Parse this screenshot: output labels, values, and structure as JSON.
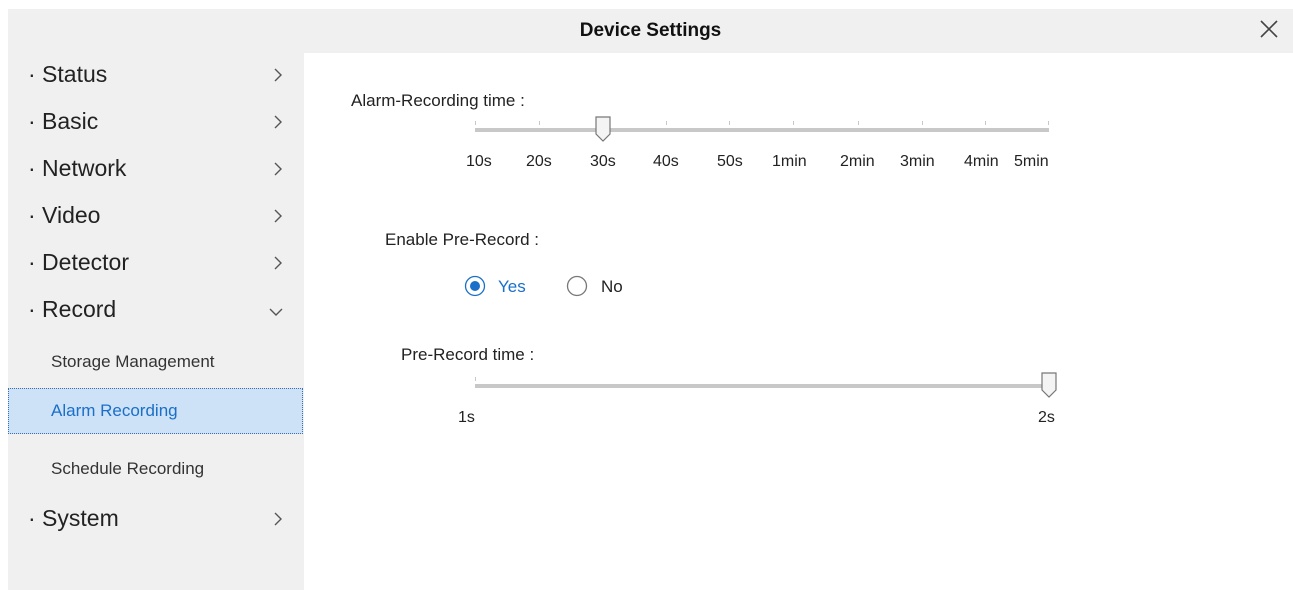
{
  "window": {
    "title": "Device Settings"
  },
  "sidebar": {
    "items": [
      {
        "label": "· Status"
      },
      {
        "label": "· Basic"
      },
      {
        "label": "· Network"
      },
      {
        "label": "· Video"
      },
      {
        "label": "· Detector"
      },
      {
        "label": "· Record"
      },
      {
        "label": "· System"
      }
    ],
    "record_subitems": [
      {
        "label": "Storage Management"
      },
      {
        "label": "Alarm Recording"
      },
      {
        "label": "Schedule Recording"
      }
    ]
  },
  "alarm_recording": {
    "label": "Alarm-Recording time :",
    "ticks": [
      "10s",
      "20s",
      "30s",
      "40s",
      "50s",
      "1min",
      "2min",
      "3min",
      "4min",
      "5min"
    ],
    "selected": "30s"
  },
  "pre_record": {
    "label": "Enable Pre-Record :",
    "options": [
      "Yes",
      "No"
    ],
    "selected": "Yes"
  },
  "pre_record_time": {
    "label": "Pre-Record time :",
    "ticks": [
      "1s",
      "2s"
    ],
    "selected": "2s"
  },
  "colors": {
    "accent": "#1a6fc8",
    "selected_bg": "#cde1f7",
    "panel_bg": "#f0f0f0"
  }
}
